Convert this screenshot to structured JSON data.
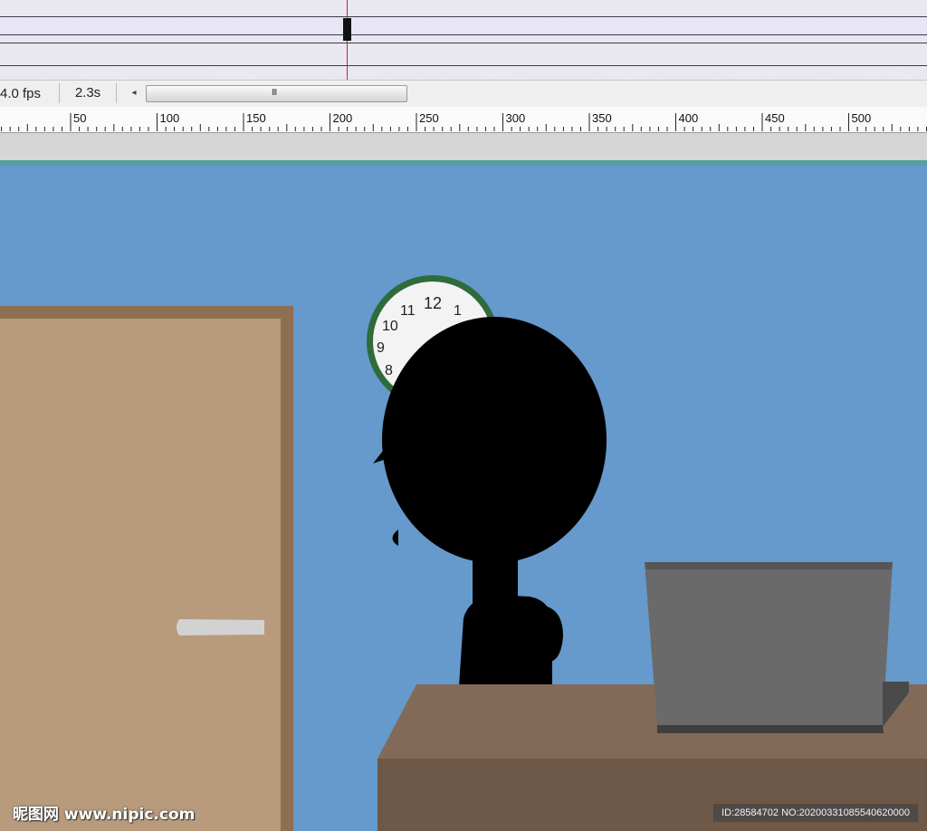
{
  "status_bar": {
    "fps": "4.0 fps",
    "time": "2.3s",
    "scroll_left_arrow": "◂",
    "scroll_grip": "III"
  },
  "ruler": {
    "labels": [
      "50",
      "100",
      "150",
      "200",
      "250",
      "300",
      "350",
      "400",
      "450",
      "500"
    ]
  },
  "scene": {
    "clock_numbers": [
      "12",
      "1",
      "11",
      "10",
      "9",
      "8"
    ],
    "colors": {
      "wall": "#6699cc",
      "door": "#b89a7c",
      "door_frame": "#8f6f52",
      "door_handle": "#d2d2d2",
      "desk_top": "#836a58",
      "desk_front": "#6e5848",
      "laptop_screen": "#6a6a6a",
      "laptop_base": "#3f3f3f",
      "clock_rim": "#2f6b3b",
      "clock_face": "#f3f3f3",
      "silhouette": "#000000"
    }
  },
  "watermark": {
    "left_text": "昵图网 www.nipic.com",
    "right_text": "ID:28584702 NO:20200331085540620000"
  }
}
